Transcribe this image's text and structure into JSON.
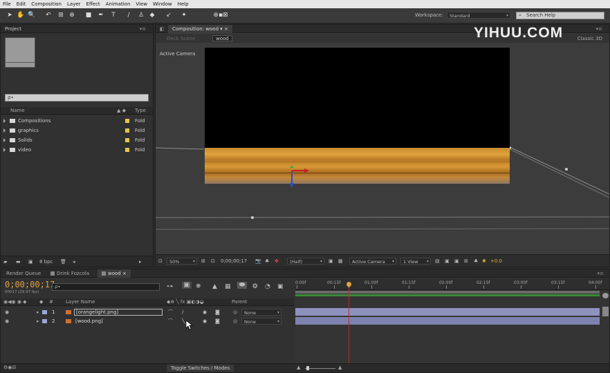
{
  "menu": [
    "File",
    "Edit",
    "Composition",
    "Layer",
    "Effect",
    "Animation",
    "View",
    "Window",
    "Help"
  ],
  "toolbar": {
    "workspace_label": "Workspace:",
    "workspace_value": "Standard",
    "search_placeholder": "Search Help"
  },
  "watermark": "YIHUU.COM",
  "project": {
    "title": "Project",
    "search_placeholder": "ρ∙",
    "col_name": "Name",
    "col_type": "Type",
    "items": [
      {
        "name": "Compositions",
        "type": "Fold"
      },
      {
        "name": "graphics",
        "type": "Fold"
      },
      {
        "name": "Solids",
        "type": "Fold"
      },
      {
        "name": "video",
        "type": "Fold"
      }
    ],
    "bpc": "8 bpc"
  },
  "composition": {
    "tab": "Composition: wood",
    "breadcrumb_inactive": "Deck Scene",
    "breadcrumb_active": "wood",
    "renderer": "Classic 3D",
    "view_label": "Active Camera",
    "zoom": "50%",
    "timecode": "0;00;00;17",
    "resolution": "(Half)",
    "camera": "Active Camera",
    "views": "1 View",
    "exposure": "+0.0"
  },
  "timeline": {
    "tabs": [
      "Render Queue",
      "Drink Fozcola",
      "wood"
    ],
    "timecode": "0;00;00;17",
    "frame_info": "00017 (29.97 fps)",
    "search_placeholder": "ρ∙",
    "col_layer_name": "Layer Name",
    "col_parent": "Parent",
    "layers": [
      {
        "num": "1",
        "name": "[orangelight.png]",
        "parent": "None"
      },
      {
        "num": "2",
        "name": "[wood.png]",
        "parent": "None"
      }
    ],
    "ruler": [
      "0:00f",
      "00:15f",
      "01:00f",
      "01:15f",
      "02:00f",
      "02:15f",
      "03:00f",
      "03:15f",
      "04:00f"
    ],
    "toggle_label": "Toggle Switches / Modes"
  }
}
